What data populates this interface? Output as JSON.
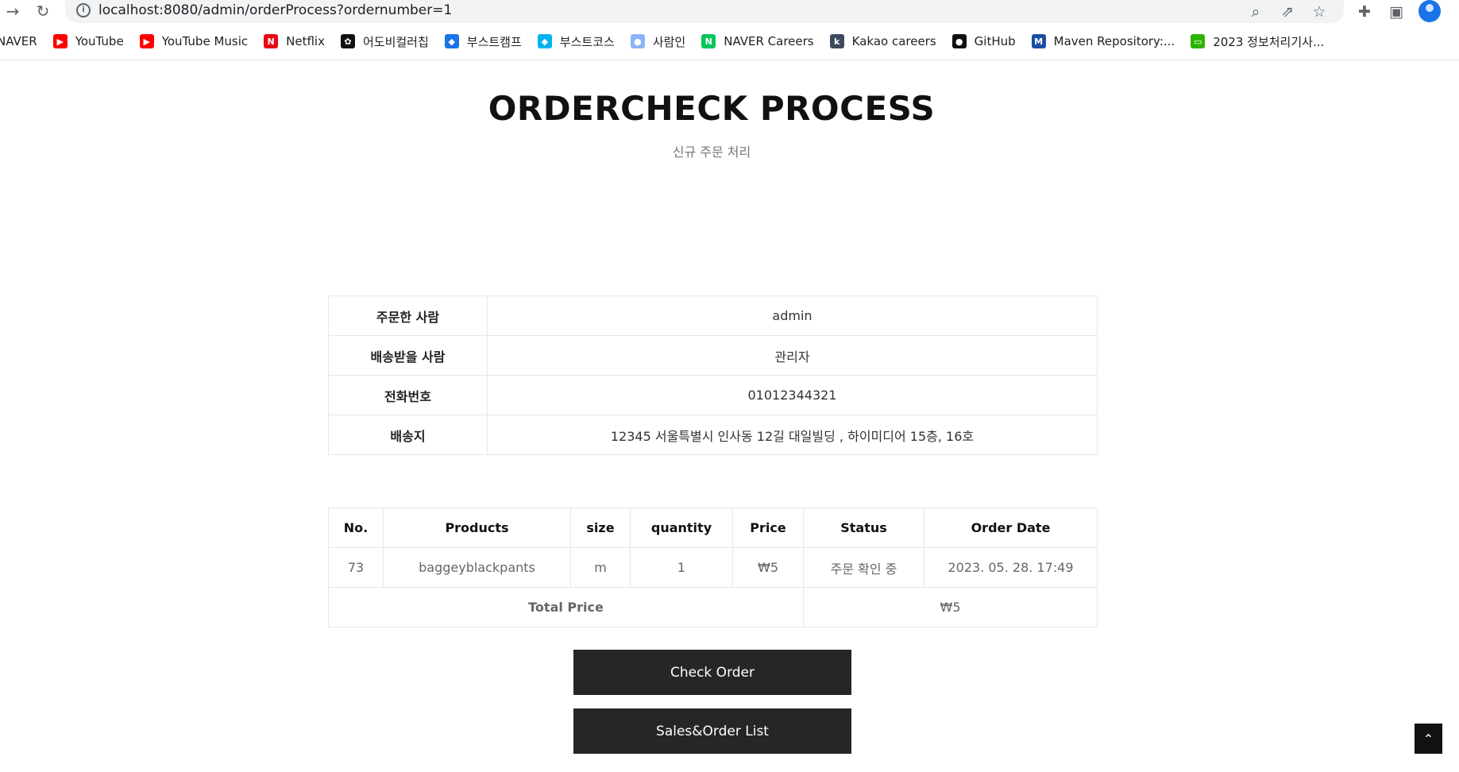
{
  "browser": {
    "url": "localhost:8080/admin/orderProcess?ordernumber=1",
    "nav_icons": [
      "forward-icon",
      "reload-icon"
    ],
    "omnibox_icons": [
      "zoom-icon",
      "share-icon",
      "star-icon"
    ],
    "toolbar_icons": [
      "extensions-icon",
      "side-panel-icon",
      "profile-icon"
    ]
  },
  "bookmarks": [
    {
      "label": "NAVER",
      "icon": "",
      "color": ""
    },
    {
      "label": "YouTube",
      "icon": "▶",
      "color": "#ff0000"
    },
    {
      "label": "YouTube Music",
      "icon": "▶",
      "color": "#ff0000"
    },
    {
      "label": "Netflix",
      "icon": "N",
      "color": "#e50914"
    },
    {
      "label": "어도비컬러칩",
      "icon": "✿",
      "color": "#111111"
    },
    {
      "label": "부스트캠프",
      "icon": "◆",
      "color": "#1a73e8"
    },
    {
      "label": "부스트코스",
      "icon": "◆",
      "color": "#00b4f0"
    },
    {
      "label": "사람인",
      "icon": "●",
      "color": "#8ab4f8"
    },
    {
      "label": "NAVER Careers",
      "icon": "N",
      "color": "#03c75a"
    },
    {
      "label": "Kakao careers",
      "icon": "k",
      "color": "#3c4a5c"
    },
    {
      "label": "GitHub",
      "icon": "●",
      "color": "#111111"
    },
    {
      "label": "Maven Repository:...",
      "icon": "M",
      "color": "#1a4fa0"
    },
    {
      "label": "2023 정보처리기사...",
      "icon": "▭",
      "color": "#2db400"
    }
  ],
  "page": {
    "title": "ORDERCHECK PROCESS",
    "subtitle": "신규 주문 처리"
  },
  "order_info": [
    {
      "label": "주문한 사람",
      "value": "admin"
    },
    {
      "label": "배송받을 사람",
      "value": "관리자"
    },
    {
      "label": "전화번호",
      "value": "01012344321"
    },
    {
      "label": "배송지",
      "value": "12345 서울특별시 인사동 12길 대일빌딩 , 하이미디어 15층, 16호"
    }
  ],
  "order_table": {
    "headers": [
      "No.",
      "Products",
      "size",
      "quantity",
      "Price",
      "Status",
      "Order Date"
    ],
    "rows": [
      [
        "73",
        "baggeyblackpants",
        "m",
        "1",
        "₩5",
        "주문 확인 중",
        "2023. 05. 28. 17:49"
      ]
    ],
    "total_label": "Total Price",
    "total_value": "₩5"
  },
  "buttons": {
    "check_order": "Check Order",
    "sales_list": "Sales&Order List",
    "scroll_top": "⌃"
  }
}
